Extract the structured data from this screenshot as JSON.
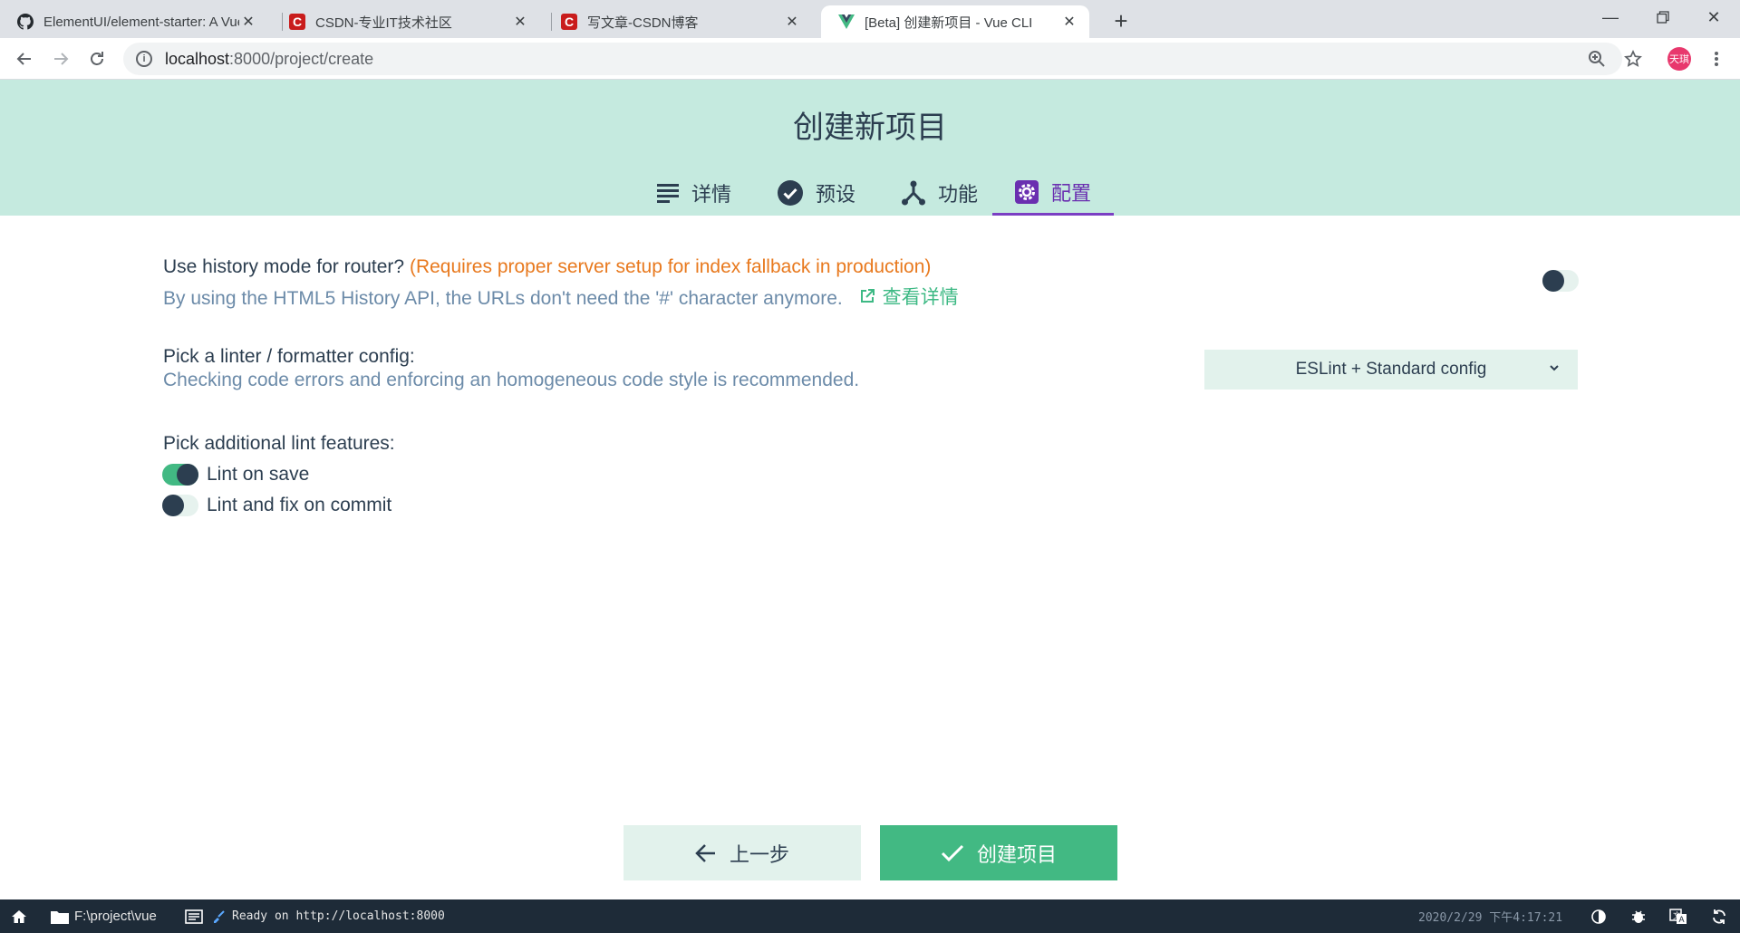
{
  "browser": {
    "tabs": [
      {
        "title": "ElementUI/element-starter: A Vue",
        "favicon": "github-icon"
      },
      {
        "title": "CSDN-专业IT技术社区",
        "favicon": "csdn-icon"
      },
      {
        "title": "写文章-CSDN博客",
        "favicon": "csdn-icon"
      },
      {
        "title": "[Beta] 创建新项目 - Vue CLI",
        "favicon": "vue-icon"
      }
    ],
    "url_host": "localhost",
    "url_path": ":8000/project/create",
    "profile_initials": "天琪"
  },
  "page": {
    "title": "创建新项目",
    "steps": [
      {
        "label": "详情",
        "icon": "list-icon"
      },
      {
        "label": "预设",
        "icon": "check-circle-icon"
      },
      {
        "label": "功能",
        "icon": "fork-icon"
      },
      {
        "label": "配置",
        "icon": "settings-icon"
      }
    ],
    "active_step": "配置"
  },
  "config": {
    "history_mode": {
      "label": "Use history mode for router?",
      "warning": "(Requires proper server setup for index fallback in production)",
      "description": "By using the HTML5 History API, the URLs don't need the '#' character anymore.",
      "link": "查看详情",
      "enabled": false
    },
    "linter": {
      "label": "Pick a linter / formatter config:",
      "description": "Checking code errors and enforcing an homogeneous code style is recommended.",
      "selected": "ESLint + Standard config"
    },
    "lint_features": {
      "label": "Pick additional lint features:",
      "options": [
        {
          "label": "Lint on save",
          "checked": true
        },
        {
          "label": "Lint and fix on commit",
          "checked": false
        }
      ]
    }
  },
  "actions": {
    "prev": "上一步",
    "create": "创建项目"
  },
  "statusbar": {
    "folder": "F:\\project\\vue",
    "log": "Ready on http://localhost:8000",
    "datetime": "2020/2/29 下午4:17:21"
  },
  "colors": {
    "header_bg": "#c5eadf",
    "accent": "#42b983",
    "active_step": "#7b3fc3",
    "warning": "#e8791e",
    "statusbar_bg": "#1e2b38"
  }
}
